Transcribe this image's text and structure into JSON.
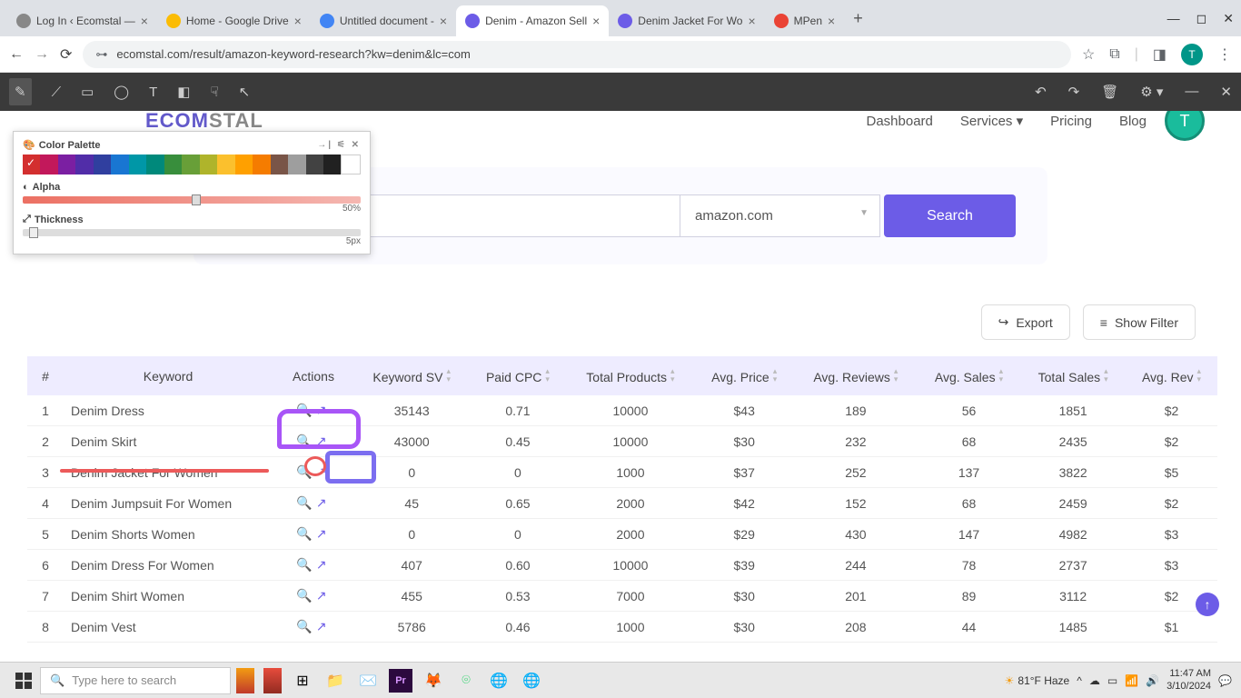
{
  "browser": {
    "tabs": [
      {
        "title": "Log In ‹ Ecomstal — ",
        "fav": "#888"
      },
      {
        "title": "Home - Google Drive",
        "fav": "#fbbc05"
      },
      {
        "title": "Untitled document - ",
        "fav": "#4285f4"
      },
      {
        "title": "Denim - Amazon Sell",
        "fav": "#6c5ce7"
      },
      {
        "title": "Denim Jacket For Wo",
        "fav": "#6c5ce7"
      },
      {
        "title": "MPen",
        "fav": "#ea4335"
      }
    ],
    "active_tab": 3,
    "url": "ecomstal.com/result/amazon-keyword-research?kw=denim&lc=com",
    "profile_letter": "T"
  },
  "palette": {
    "title": "Color Palette",
    "colors": [
      "#d32f2f",
      "#c2185b",
      "#7b1fa2",
      "#512da8",
      "#303f9f",
      "#1976d2",
      "#0097a7",
      "#00897b",
      "#388e3c",
      "#689f38",
      "#afb42b",
      "#fbc02d",
      "#ffa000",
      "#f57c00",
      "#795548",
      "#9e9e9e",
      "#424242",
      "#212121",
      "#ffffff"
    ],
    "selected": 0,
    "alpha_label": "Alpha",
    "alpha_value": "50%",
    "thickness_label": "Thickness",
    "thickness_value": "5px"
  },
  "header": {
    "logo_a": "ECOM",
    "logo_b": "STAL",
    "links": [
      "Dashboard",
      "Services ▾",
      "Pricing",
      "Blog"
    ],
    "avatar": "T"
  },
  "search": {
    "keyword": "denim",
    "marketplace": "amazon.com",
    "button": "Search"
  },
  "buttons": {
    "export": "Export",
    "filter": "Show Filter"
  },
  "table": {
    "headers": [
      "#",
      "Keyword",
      "Actions",
      "Keyword SV",
      "Paid CPC",
      "Total Products",
      "Avg. Price",
      "Avg. Reviews",
      "Avg. Sales",
      "Total Sales",
      "Avg. Rev"
    ],
    "rows": [
      {
        "n": "1",
        "kw": "Denim Dress",
        "sv": "35143",
        "cpc": "0.71",
        "tp": "10000",
        "price": "$43",
        "rev": "189",
        "sales": "56",
        "ts": "1851",
        "ar": "$2"
      },
      {
        "n": "2",
        "kw": "Denim Skirt",
        "sv": "43000",
        "cpc": "0.45",
        "tp": "10000",
        "price": "$30",
        "rev": "232",
        "sales": "68",
        "ts": "2435",
        "ar": "$2"
      },
      {
        "n": "3",
        "kw": "Denim Jacket For Women",
        "sv": "0",
        "cpc": "0",
        "tp": "1000",
        "price": "$37",
        "rev": "252",
        "sales": "137",
        "ts": "3822",
        "ar": "$5"
      },
      {
        "n": "4",
        "kw": "Denim Jumpsuit For Women",
        "sv": "45",
        "cpc": "0.65",
        "tp": "2000",
        "price": "$42",
        "rev": "152",
        "sales": "68",
        "ts": "2459",
        "ar": "$2"
      },
      {
        "n": "5",
        "kw": "Denim Shorts Women",
        "sv": "0",
        "cpc": "0",
        "tp": "2000",
        "price": "$29",
        "rev": "430",
        "sales": "147",
        "ts": "4982",
        "ar": "$3"
      },
      {
        "n": "6",
        "kw": "Denim Dress For Women",
        "sv": "407",
        "cpc": "0.60",
        "tp": "10000",
        "price": "$39",
        "rev": "244",
        "sales": "78",
        "ts": "2737",
        "ar": "$3"
      },
      {
        "n": "7",
        "kw": "Denim Shirt Women",
        "sv": "455",
        "cpc": "0.53",
        "tp": "7000",
        "price": "$30",
        "rev": "201",
        "sales": "89",
        "ts": "3112",
        "ar": "$2"
      },
      {
        "n": "8",
        "kw": "Denim Vest",
        "sv": "5786",
        "cpc": "0.46",
        "tp": "1000",
        "price": "$30",
        "rev": "208",
        "sales": "44",
        "ts": "1485",
        "ar": "$1"
      }
    ]
  },
  "taskbar": {
    "search_placeholder": "Type here to search",
    "weather": "81°F Haze",
    "time": "11:47 AM",
    "date": "3/10/2024"
  }
}
